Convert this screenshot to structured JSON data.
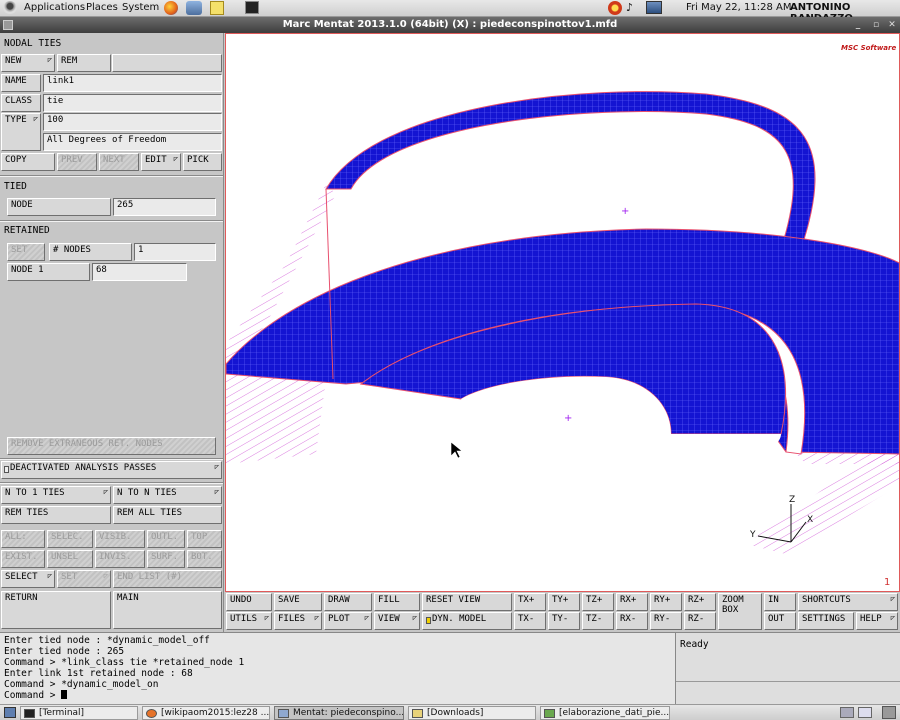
{
  "topbar": {
    "applications": "Applications",
    "places": "Places",
    "system": "System",
    "datetime": "Fri May 22, 11:28 AM",
    "user": "ANTONINO RANDAZZO"
  },
  "window": {
    "title": "Marc Mentat 2013.1.0 (64bit) (X) : piedeconspinottov1.mfd"
  },
  "panel": {
    "section": "NODAL TIES",
    "new": "NEW",
    "rem": "REM",
    "name_label": "NAME",
    "name_value": "link1",
    "class_label": "CLASS",
    "class_value": "tie",
    "type_label": "TYPE",
    "type_value": "100",
    "type_desc": "All Degrees of Freedom",
    "copy": "COPY",
    "prev": "PREV",
    "next": "NEXT",
    "edit": "EDIT",
    "pick": "PICK",
    "tied": "TIED",
    "tied_node_label": "NODE",
    "tied_node_value": "265",
    "retained": "RETAINED",
    "set": "SET",
    "num_nodes_label": "# NODES",
    "num_nodes_value": "1",
    "node1_label": "NODE 1",
    "node1_value": "68",
    "remove_extraneous": "REMOVE EXTRANEOUS RET. NODES",
    "deactivated": "DEACTIVATED ANALYSIS PASSES",
    "n_to_1": "N TO 1 TIES",
    "n_to_n": "N TO N TIES",
    "rem_ties": "REM TIES",
    "rem_all_ties": "REM ALL TIES",
    "sel_row1": [
      "ALL:",
      "SELEC.",
      "VISIB.",
      "OUTL.",
      "TOP"
    ],
    "sel_row2": [
      "EXIST.",
      "UNSEL",
      "INVIS.",
      "SURF.",
      "BOT."
    ],
    "select": "SELECT",
    "set2": "SET",
    "end_list": "END LIST (#)",
    "return": "RETURN",
    "main": "MAIN"
  },
  "viewport": {
    "brand": "MSC Software",
    "viewport_number": "1",
    "axis_x": "X",
    "axis_y": "Y",
    "axis_z": "Z",
    "mesh_color": "#1414d2",
    "edge_color": "#e8506e"
  },
  "toolbar": {
    "undo": "UNDO",
    "save": "SAVE",
    "draw": "DRAW",
    "fill": "FILL",
    "reset_view": "RESET VIEW",
    "utils": "UTILS",
    "files": "FILES",
    "plot": "PLOT",
    "view": "VIEW",
    "dyn_model": "DYN. MODEL",
    "tx_plus": "TX+",
    "ty_plus": "TY+",
    "tz_plus": "TZ+",
    "rx_plus": "RX+",
    "ry_plus": "RY+",
    "rz_plus": "RZ+",
    "tx_minus": "TX-",
    "ty_minus": "TY-",
    "tz_minus": "TZ-",
    "rx_minus": "RX-",
    "ry_minus": "RY-",
    "rz_minus": "RZ-",
    "zoom_box": "ZOOM BOX",
    "in": "IN",
    "out": "OUT",
    "shortcuts": "SHORTCUTS",
    "settings": "SETTINGS",
    "help": "HELP"
  },
  "console": {
    "lines": [
      "Enter tied node : *dynamic_model_off",
      "Enter tied node :  265",
      "Command > *link_class tie *retained_node 1",
      "Enter link 1st retained node :  68",
      "Command > *dynamic_model_on",
      "Command > "
    ]
  },
  "status": {
    "text": "Ready"
  },
  "taskbar": {
    "items": [
      "[Terminal]",
      "[wikipaom2015:lez28 ...",
      "Mentat: piedeconspino...",
      "[Downloads]",
      "[elaborazione_dati_pie..."
    ]
  }
}
